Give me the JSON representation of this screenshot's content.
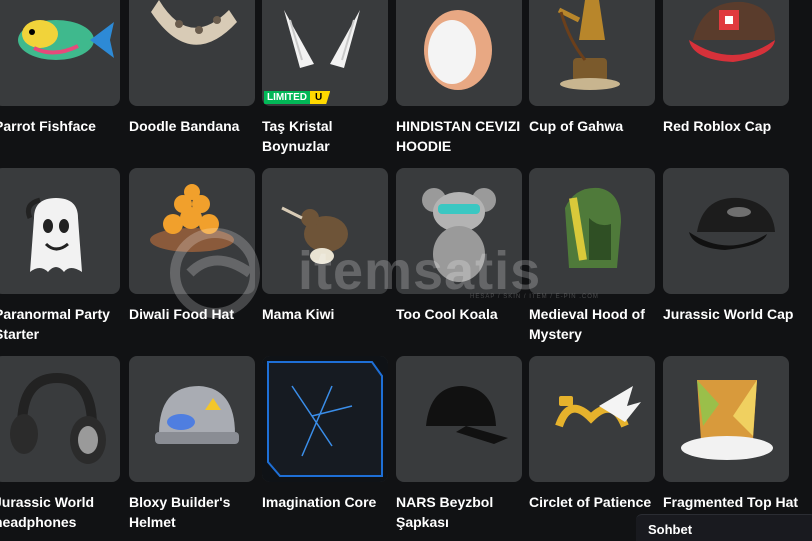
{
  "items": [
    {
      "name": "Parrot Fishface",
      "icon": "fish-icon"
    },
    {
      "name": "Doodle Bandana",
      "icon": "bandana-icon"
    },
    {
      "name": "Taş Kristal Boynuzlar",
      "icon": "crystal-horns-icon",
      "badge": {
        "limited": "LIMITED",
        "u": "U"
      }
    },
    {
      "name": "HINDISTAN CEVIZI HOODIE",
      "icon": "coconut-icon"
    },
    {
      "name": "Cup of Gahwa",
      "icon": "coffee-pot-icon"
    },
    {
      "name": "Red Roblox Cap",
      "icon": "cap-icon"
    },
    {
      "name": "Paranormal Party Starter",
      "icon": "ghost-icon"
    },
    {
      "name": "Diwali Food Hat",
      "icon": "food-bowl-icon"
    },
    {
      "name": "Mama Kiwi",
      "icon": "kiwi-bird-icon"
    },
    {
      "name": "Too Cool Koala",
      "icon": "koala-icon"
    },
    {
      "name": "Medieval Hood of Mystery",
      "icon": "hood-icon"
    },
    {
      "name": "Jurassic World Cap",
      "icon": "cap-icon"
    },
    {
      "name": "Jurassic World headphones",
      "icon": "headphones-icon"
    },
    {
      "name": "Bloxy Builder's Helmet",
      "icon": "helmet-icon"
    },
    {
      "name": "Imagination Core",
      "icon": "cube-icon"
    },
    {
      "name": "NARS Beyzbol Şapkası",
      "icon": "cap-icon"
    },
    {
      "name": "Circlet of Patience",
      "icon": "circlet-icon"
    },
    {
      "name": "Fragmented Top Hat",
      "icon": "top-hat-icon"
    }
  ],
  "watermark": {
    "brand": "itemsatis",
    "tagline": "HESAP / SKIN / ITEM / E-PIN .COM"
  },
  "chat": {
    "label": "Sohbet"
  }
}
